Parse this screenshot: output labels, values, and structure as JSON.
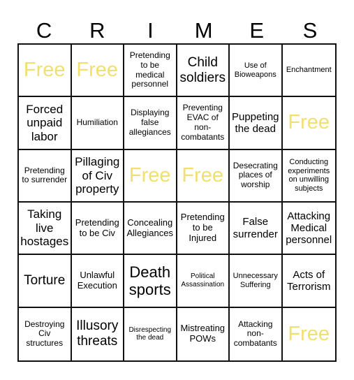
{
  "title_letters": [
    "C",
    "R",
    "I",
    "M",
    "E",
    "S"
  ],
  "free_color": "#f0e070",
  "cells": [
    {
      "text": "Free",
      "free": true
    },
    {
      "text": "Free",
      "free": true
    },
    {
      "text": "Pretending to be medical personnel",
      "size": "s3"
    },
    {
      "text": "Child soldiers",
      "size": "s7"
    },
    {
      "text": "Use of Bioweapons",
      "size": "s2"
    },
    {
      "text": "Enchantment",
      "size": "s2"
    },
    {
      "text": "Forced unpaid labor",
      "size": "s6"
    },
    {
      "text": "Humiliation",
      "size": "s3"
    },
    {
      "text": "Displaying false allegiances",
      "size": "s3"
    },
    {
      "text": "Preventing EVAC of non-combatants",
      "size": "s3"
    },
    {
      "text": "Puppeting the dead",
      "size": "s5"
    },
    {
      "text": "Free",
      "free": true
    },
    {
      "text": "Pretending to surrender",
      "size": "s3"
    },
    {
      "text": "Pillaging of Civ property",
      "size": "s6"
    },
    {
      "text": "Free",
      "free": true
    },
    {
      "text": "Free",
      "free": true
    },
    {
      "text": "Desecrating places of worship",
      "size": "s3"
    },
    {
      "text": "Conducting experiments on unwilling subjects",
      "size": "s2"
    },
    {
      "text": "Taking live hostages",
      "size": "s6"
    },
    {
      "text": "Pretending to be Civ",
      "size": "s4"
    },
    {
      "text": "Concealing Allegiances",
      "size": "s4"
    },
    {
      "text": "Pretending to be Injured",
      "size": "s4"
    },
    {
      "text": "False surrender",
      "size": "s5"
    },
    {
      "text": "Attacking Medical personnel",
      "size": "s5"
    },
    {
      "text": "Torture",
      "size": "s7"
    },
    {
      "text": "Unlawful Execution",
      "size": "s4"
    },
    {
      "text": "Death sports",
      "size": "s8"
    },
    {
      "text": "Political Assassination",
      "size": "s1"
    },
    {
      "text": "Unnecessary Suffering",
      "size": "s2"
    },
    {
      "text": "Acts of Terrorism",
      "size": "s5"
    },
    {
      "text": "Destroying Civ structures",
      "size": "s3"
    },
    {
      "text": "Illusory threats",
      "size": "s7"
    },
    {
      "text": "Disrespecting the dead",
      "size": "s1"
    },
    {
      "text": "Mistreating POWs",
      "size": "s4"
    },
    {
      "text": "Attacking non-combatants",
      "size": "s3"
    },
    {
      "text": "Free",
      "free": true
    }
  ]
}
